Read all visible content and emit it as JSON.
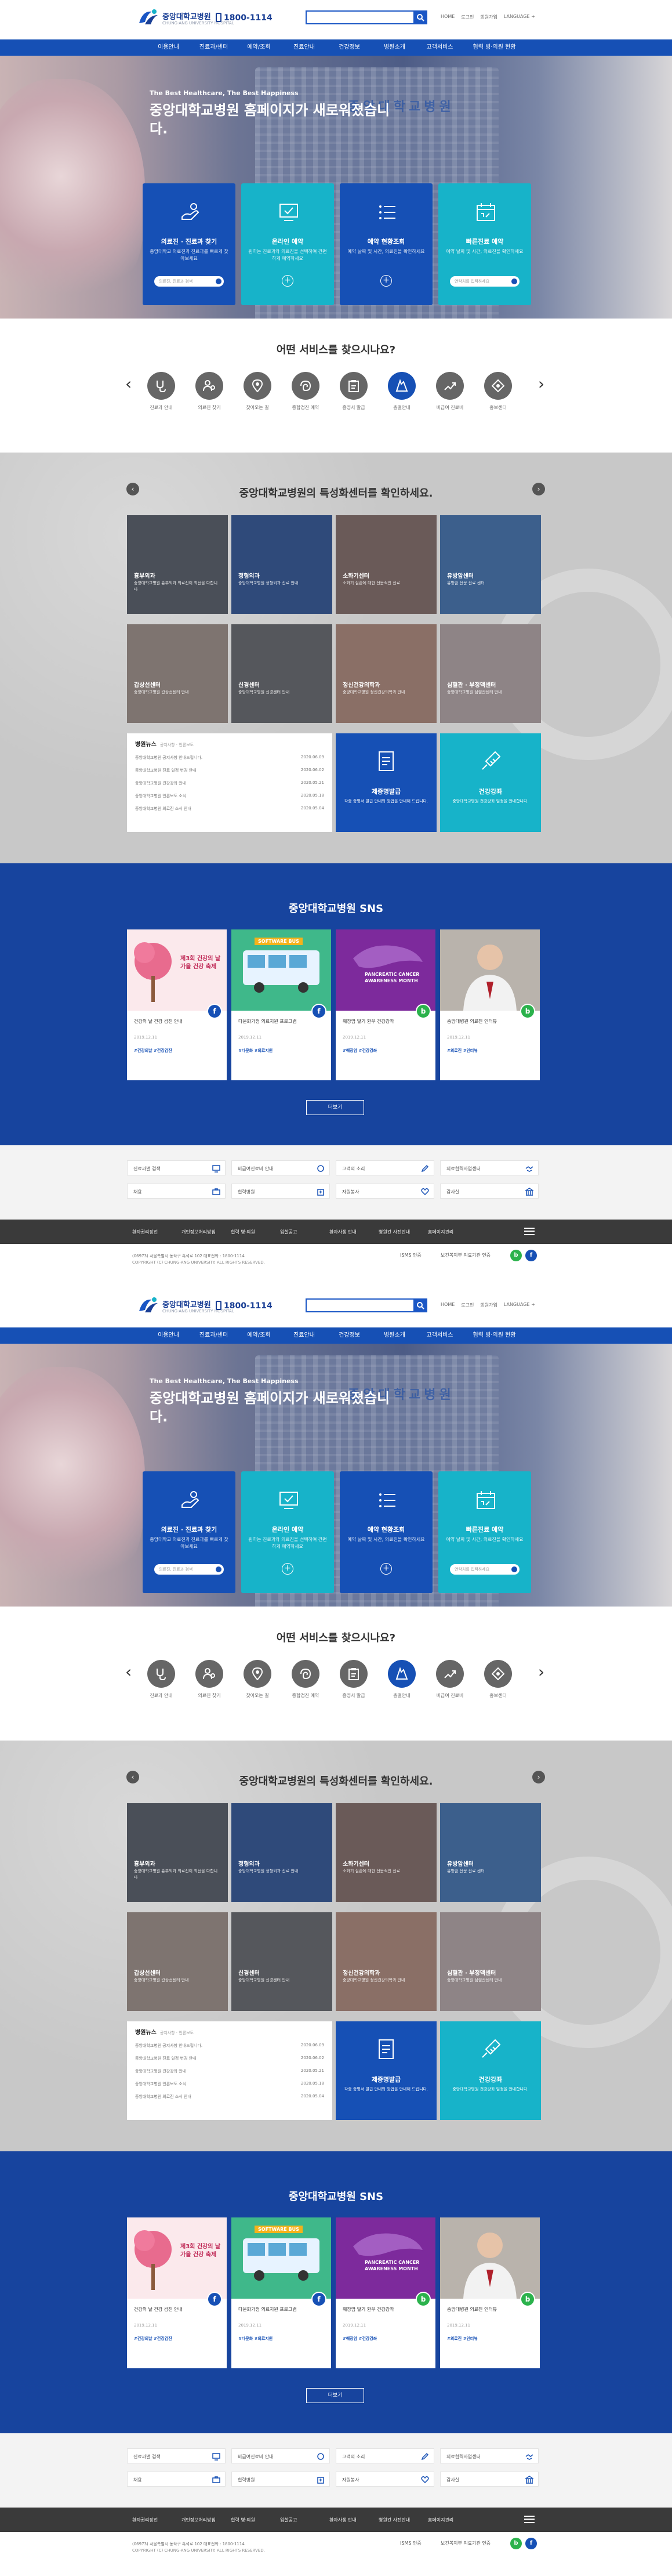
{
  "header": {
    "logo_title": "중앙대학교병원",
    "logo_subtitle": "CHUNG-ANG UNIVERSITY HOSPITAL",
    "phone": "1800-1114",
    "search_placeholder": "",
    "util_links": [
      "HOME",
      "로그인",
      "회원가입",
      "LANGUAGE +"
    ]
  },
  "nav": {
    "items": [
      "이용안내",
      "진료과/센터",
      "예약/조회",
      "진료안내",
      "건강정보",
      "병원소개",
      "고객서비스",
      "협력 병·의원 현황"
    ]
  },
  "hero": {
    "subtitle": "The Best Healthcare, The Best Happiness",
    "title": "중앙대학교병원 홈페이지가 새로워졌습니다.",
    "building_sign": "중앙대학교병원",
    "cards": [
      {
        "label": "의료진 · 진료과 찾기",
        "desc": "중앙대학교 의료진과 진료과를 빠르게 찾아보세요",
        "input_placeholder": "의료진, 진료과 검색",
        "color": "#1650b5",
        "icon": "doctor-search-icon"
      },
      {
        "label": "온라인 예약",
        "desc": "원하는 진료과와 의료진을 선택하여 간편하게 예약하세요",
        "color": "#17b3c9",
        "icon": "online-reservation-icon"
      },
      {
        "label": "예약 현황조회",
        "desc": "예약 날짜 및 시간, 의료진을 확인하세요",
        "color": "#1650b5",
        "icon": "reservation-status-icon"
      },
      {
        "label": "빠른진료 예약",
        "desc": "예약 날짜 및 시간, 의료진을 확인하세요",
        "input_placeholder": "연락처를 입력하세요",
        "color": "#17b3c9",
        "icon": "quick-reservation-icon"
      }
    ]
  },
  "services": {
    "title": "어떤 서비스를 찾으시나요?",
    "items": [
      {
        "label": "진료과 안내",
        "icon": "stethoscope-icon"
      },
      {
        "label": "의료진 찾기",
        "icon": "doctor-icon"
      },
      {
        "label": "찾아오는 길",
        "icon": "location-icon"
      },
      {
        "label": "종합검진 예약",
        "icon": "checkup-icon"
      },
      {
        "label": "증명서 발급",
        "icon": "certificate-icon"
      },
      {
        "label": "층별안내",
        "icon": "floor-guide-icon"
      },
      {
        "label": "비급여 진료비",
        "icon": "fee-icon"
      },
      {
        "label": "홍보센터",
        "icon": "promotion-icon"
      },
      {
        "label": "주차비용 환율안내",
        "icon": "parking-icon"
      }
    ]
  },
  "specialty": {
    "title": "중앙대학교병원의 특성화센터를 확인하세요.",
    "tiles": [
      {
        "name": "흉부외과",
        "desc": "중앙대학교병원 흉부외과 의료진이 최선을 다합니다",
        "bg": "#4a4f58"
      },
      {
        "name": "정형외과",
        "desc": "중앙대학교병원 정형외과 진료 안내",
        "bg": "#2f4a7a"
      },
      {
        "name": "소화기센터",
        "desc": "소화기 질환에 대한 전문적인 진료",
        "bg": "#6a5a58"
      },
      {
        "name": "유방암센터",
        "desc": "유방암 전문 진료 센터",
        "bg": "#3c5f8c"
      },
      {
        "name": "갑상선센터",
        "desc": "중앙대학교병원 갑상선센터 안내",
        "bg": "#7e7470"
      },
      {
        "name": "신경센터",
        "desc": "중앙대학교병원 신경센터 안내",
        "bg": "#55575c"
      },
      {
        "name": "정신건강의학과",
        "desc": "중앙대학교병원 정신건강의학과 안내",
        "bg": "#8a6f66"
      },
      {
        "name": "심혈관 · 부정맥센터",
        "desc": "중앙대학교병원 심혈관센터 안내",
        "bg": "#8e8486"
      }
    ],
    "news": {
      "title": "병원뉴스",
      "subtitle": "공지사항 · 언론보도",
      "rows": [
        {
          "text": "중앙대학교병원 공지사항 안내드립니다.",
          "date": "2020.06.09"
        },
        {
          "text": "중앙대학교병원 진료 일정 변경 안내",
          "date": "2020.06.02"
        },
        {
          "text": "중앙대학교병원 건강강좌 안내",
          "date": "2020.05.21"
        },
        {
          "text": "중앙대학교병원 언론보도 소식",
          "date": "2020.05.18"
        },
        {
          "text": "중앙대학교병원 의료진 소식 안내",
          "date": "2020.05.04"
        }
      ]
    },
    "blue_cards": [
      {
        "label": "제증명발급",
        "desc": "각종 증명서 발급 안내와 방법을 안내해 드립니다.",
        "color": "#1650b5",
        "icon": "document-icon"
      },
      {
        "label": "건강강좌",
        "desc": "중앙대학교병원 건강강좌 일정을 안내합니다.",
        "color": "#17b3c9",
        "icon": "syringe-icon"
      }
    ]
  },
  "sns": {
    "title": "중앙대학교병원 SNS",
    "cards": [
      {
        "text": "건강의 날 건강 검진 안내",
        "date": "2019.12.11",
        "tag": "#건강의날 #건강검진",
        "badge": "f",
        "badge_color": "#1650b5",
        "img_text": "제3회 건강의 날 가을 건강 축제"
      },
      {
        "text": "다문화가정 의료지원 프로그램",
        "date": "2019.12.11",
        "tag": "#다문화 #의료지원",
        "badge": "f",
        "badge_color": "#1650b5",
        "img_text": "SOFTWARE BUS"
      },
      {
        "text": "췌장암 알기 환우 건강강좌",
        "date": "2019.12.11",
        "tag": "#췌장암 #건강강좌",
        "badge": "b",
        "badge_color": "#2bb24c",
        "img_text": "PANCREATIC CANCER AWARENESS MONTH"
      },
      {
        "text": "중앙대병원 의료진 인터뷰",
        "date": "2019.12.11",
        "tag": "#의료진 #인터뷰",
        "badge": "b",
        "badge_color": "#2bb24c",
        "img_text": ""
      }
    ],
    "more_label": "더보기"
  },
  "quick_links": {
    "items": [
      "진료과별 검색",
      "비급여진료비 안내",
      "고객의 소리",
      "의료협력사업센터",
      "채용",
      "협력병원",
      "자원봉사",
      "감사실"
    ]
  },
  "footer": {
    "links": [
      "환자권리장전",
      "개인정보처리방침",
      "협력 병·의원",
      "입찰공고",
      "환자사생 안내",
      "병원간 사전안내",
      "홈페이지관리"
    ],
    "address": "(06973) 서울특별시 동작구 흑석로 102 대표전화 : 1800-1114",
    "copyright": "COPYRIGHT (C) CHUNG-ANG UNIVERSITY. ALL RIGHTS RESERVED.",
    "badge1": "ISMS 인증",
    "badge2": "보건복지부 의료기관 인증"
  }
}
